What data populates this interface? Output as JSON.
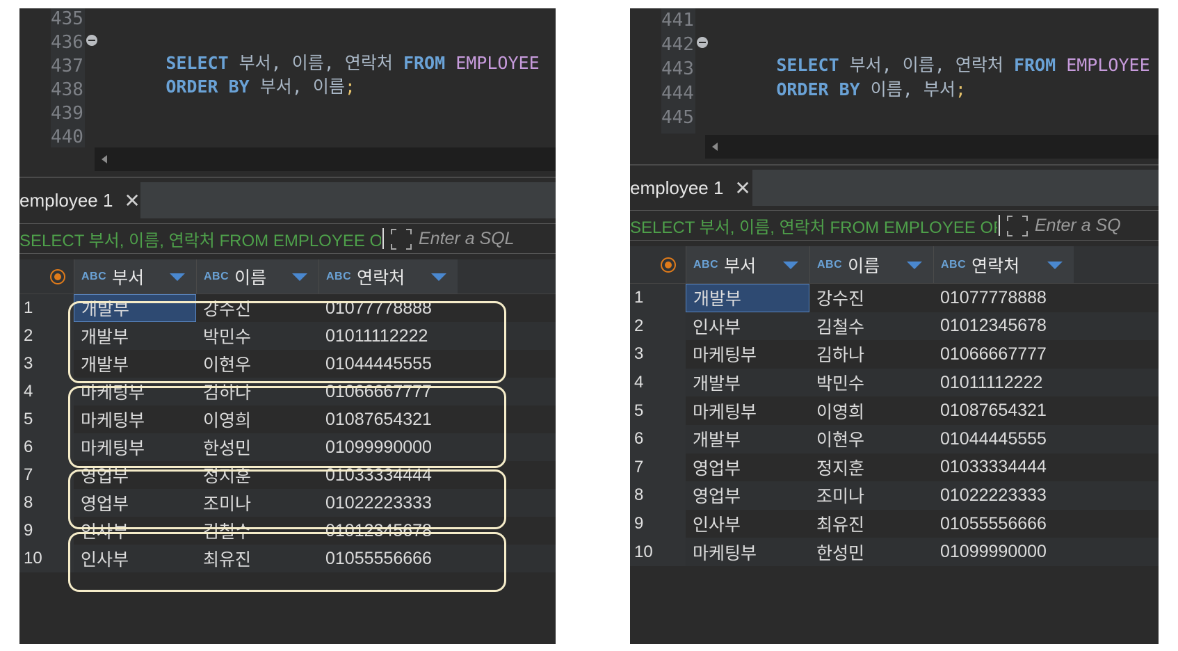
{
  "left": {
    "editor": {
      "line_numbers": [
        "435",
        "436",
        "437",
        "438",
        "439",
        "440"
      ],
      "line1": {
        "select": "SELECT",
        "cols": " 부서, 이름, 연락처 ",
        "from": "FROM",
        "table": " EMPLOYEE"
      },
      "line2": {
        "order": "ORDER",
        "by": " BY",
        "cols": " 부서, 이름",
        "semi": ";"
      }
    },
    "tab_label": "employee 1",
    "tab_close": "✕",
    "filter_text": "SELECT 부서, 이름, 연락처 FROM EMPLOYEE OF",
    "filter_placeholder": "Enter a SQL",
    "columns": [
      {
        "type": "ABC",
        "label": "부서"
      },
      {
        "type": "ABC",
        "label": "이름"
      },
      {
        "type": "ABC",
        "label": "연락처"
      }
    ],
    "rows": [
      {
        "n": "1",
        "dept": "개발부",
        "name": "강수진",
        "phone": "01077778888"
      },
      {
        "n": "2",
        "dept": "개발부",
        "name": "박민수",
        "phone": "01011112222"
      },
      {
        "n": "3",
        "dept": "개발부",
        "name": "이현우",
        "phone": "01044445555"
      },
      {
        "n": "4",
        "dept": "마케팅부",
        "name": "김하나",
        "phone": "01066667777"
      },
      {
        "n": "5",
        "dept": "마케팅부",
        "name": "이영희",
        "phone": "01087654321"
      },
      {
        "n": "6",
        "dept": "마케팅부",
        "name": "한성민",
        "phone": "01099990000"
      },
      {
        "n": "7",
        "dept": "영업부",
        "name": "정지훈",
        "phone": "01033334444"
      },
      {
        "n": "8",
        "dept": "영업부",
        "name": "조미나",
        "phone": "01022223333"
      },
      {
        "n": "9",
        "dept": "인사부",
        "name": "김철수",
        "phone": "01012345678"
      },
      {
        "n": "10",
        "dept": "인사부",
        "name": "최유진",
        "phone": "01055556666"
      }
    ]
  },
  "right": {
    "editor": {
      "line_numbers": [
        "441",
        "442",
        "443",
        "444",
        "445"
      ],
      "line1": {
        "select": "SELECT",
        "cols": " 부서, 이름, 연락처 ",
        "from": "FROM",
        "table": " EMPLOYEE"
      },
      "line2": {
        "order": "ORDER",
        "by": " BY",
        "cols": " 이름, 부서",
        "semi": ";"
      }
    },
    "tab_label": "employee 1",
    "tab_close": "✕",
    "filter_text": "SELECT 부서, 이름, 연락처 FROM EMPLOYEE OF",
    "filter_placeholder": "Enter a SQ",
    "columns": [
      {
        "type": "ABC",
        "label": "부서"
      },
      {
        "type": "ABC",
        "label": "이름"
      },
      {
        "type": "ABC",
        "label": "연락처"
      }
    ],
    "rows": [
      {
        "n": "1",
        "dept": "개발부",
        "name": "강수진",
        "phone": "01077778888"
      },
      {
        "n": "2",
        "dept": "인사부",
        "name": "김철수",
        "phone": "01012345678"
      },
      {
        "n": "3",
        "dept": "마케팅부",
        "name": "김하나",
        "phone": "01066667777"
      },
      {
        "n": "4",
        "dept": "개발부",
        "name": "박민수",
        "phone": "01011112222"
      },
      {
        "n": "5",
        "dept": "마케팅부",
        "name": "이영희",
        "phone": "01087654321"
      },
      {
        "n": "6",
        "dept": "개발부",
        "name": "이현우",
        "phone": "01044445555"
      },
      {
        "n": "7",
        "dept": "영업부",
        "name": "정지훈",
        "phone": "01033334444"
      },
      {
        "n": "8",
        "dept": "영업부",
        "name": "조미나",
        "phone": "01022223333"
      },
      {
        "n": "9",
        "dept": "인사부",
        "name": "최유진",
        "phone": "01055556666"
      },
      {
        "n": "10",
        "dept": "마케팅부",
        "name": "한성민",
        "phone": "01099990000"
      }
    ]
  },
  "colors": {
    "keyword": "#6aa2d6",
    "table_name": "#c79bdc",
    "semicolon": "#e6c26b",
    "filter_text": "#4ea04a",
    "selection": "#2e4a72",
    "group_outline": "#f5ecc9"
  }
}
